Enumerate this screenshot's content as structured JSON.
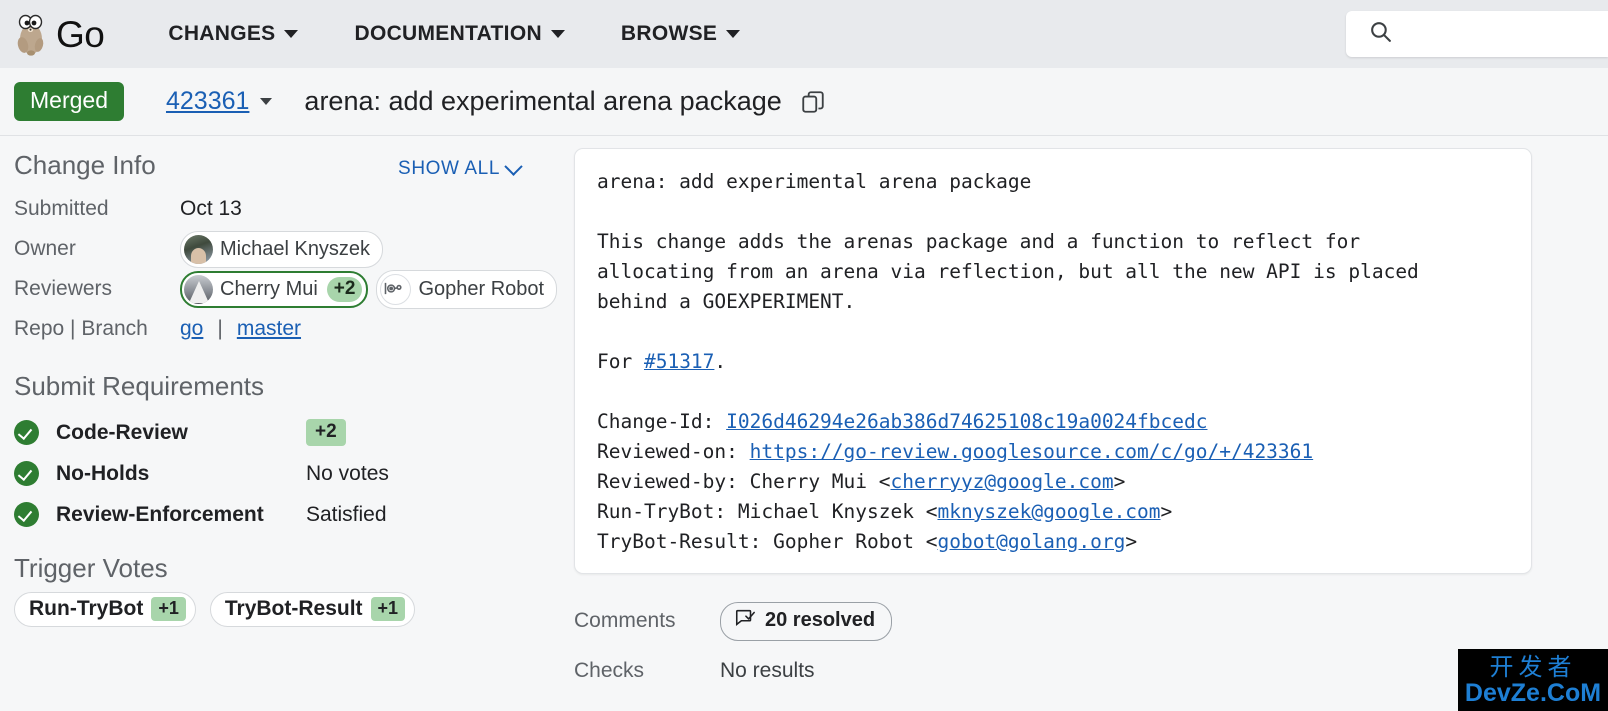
{
  "header": {
    "brand": "Go",
    "logo_icon": "go-gopher-logo",
    "nav": [
      {
        "label": "CHANGES",
        "icon": "chevron-down-icon"
      },
      {
        "label": "DOCUMENTATION",
        "icon": "chevron-down-icon"
      },
      {
        "label": "BROWSE",
        "icon": "chevron-down-icon"
      }
    ],
    "search": {
      "icon": "search-icon",
      "value": "",
      "placeholder": ""
    }
  },
  "titlebar": {
    "status": "Merged",
    "change_number": "423361",
    "dropdown_icon": "caret-down-icon",
    "title": "arena: add experimental arena package",
    "copy_icon": "copy-icon"
  },
  "sidebar": {
    "change_info_title": "Change Info",
    "show_all": "SHOW ALL",
    "show_all_icon": "chevron-down-icon",
    "rows": {
      "submitted_label": "Submitted",
      "submitted_value": "Oct 13",
      "owner_label": "Owner",
      "owner_name": "Michael Knyszek",
      "reviewers_label": "Reviewers",
      "reviewer1_name": "Cherry Mui",
      "reviewer1_vote": "+2",
      "reviewer2_name": "Gopher Robot",
      "repo_label": "Repo | Branch",
      "repo": "go",
      "repo_sep": "|",
      "branch": "master"
    },
    "submit_requirements_title": "Submit Requirements",
    "requirements": [
      {
        "icon": "check-circle-icon",
        "name": "Code-Review",
        "value": "+2",
        "is_badge": true
      },
      {
        "icon": "check-circle-icon",
        "name": "No-Holds",
        "value": "No votes",
        "is_badge": false
      },
      {
        "icon": "check-circle-icon",
        "name": "Review-Enforcement",
        "value": "Satisfied",
        "is_badge": false
      }
    ],
    "trigger_votes_title": "Trigger Votes",
    "trigger_votes": [
      {
        "label": "Run-TryBot",
        "value": "+1"
      },
      {
        "label": "TryBot-Result",
        "value": "+1"
      }
    ]
  },
  "main": {
    "commit": {
      "subject": "arena: add experimental arena package",
      "body_line1": "This change adds the arenas package and a function to reflect for",
      "body_line2": "allocating from an arena via reflection, but all the new API is placed",
      "body_line3": "behind a GOEXPERIMENT.",
      "for_prefix": "For ",
      "for_issue": "#51317",
      "for_suffix": ".",
      "change_id_label": "Change-Id: ",
      "change_id_value": "I026d46294e26ab386d74625108c19a0024fbcedc",
      "reviewed_on_label": "Reviewed-on: ",
      "reviewed_on_value": "https://go-review.googlesource.com/c/go/+/423361",
      "reviewed_by_label": "Reviewed-by: Cherry Mui <",
      "reviewed_by_email": "cherryyz@google.com",
      "reviewed_by_suffix": ">",
      "run_trybot_label": "Run-TryBot: Michael Knyszek <",
      "run_trybot_email": "mknyszek@google.com",
      "run_trybot_suffix": ">",
      "trybot_result_label": "TryBot-Result: Gopher Robot <",
      "trybot_result_email": "gobot@golang.org",
      "trybot_result_suffix": ">"
    },
    "comments_label": "Comments",
    "comments_icon": "comment-resolved-icon",
    "comments_value": "20 resolved",
    "checks_label": "Checks",
    "checks_value": "No results"
  },
  "watermark": {
    "cn": "开发者",
    "en": "DevZe.CoM"
  },
  "colors": {
    "merged_green": "#2e7d32",
    "link_blue": "#1a5fb4",
    "vote_green": "#a8d5ab",
    "header_bg": "#e8eaed",
    "watermark_blue": "#1e7fd4"
  }
}
